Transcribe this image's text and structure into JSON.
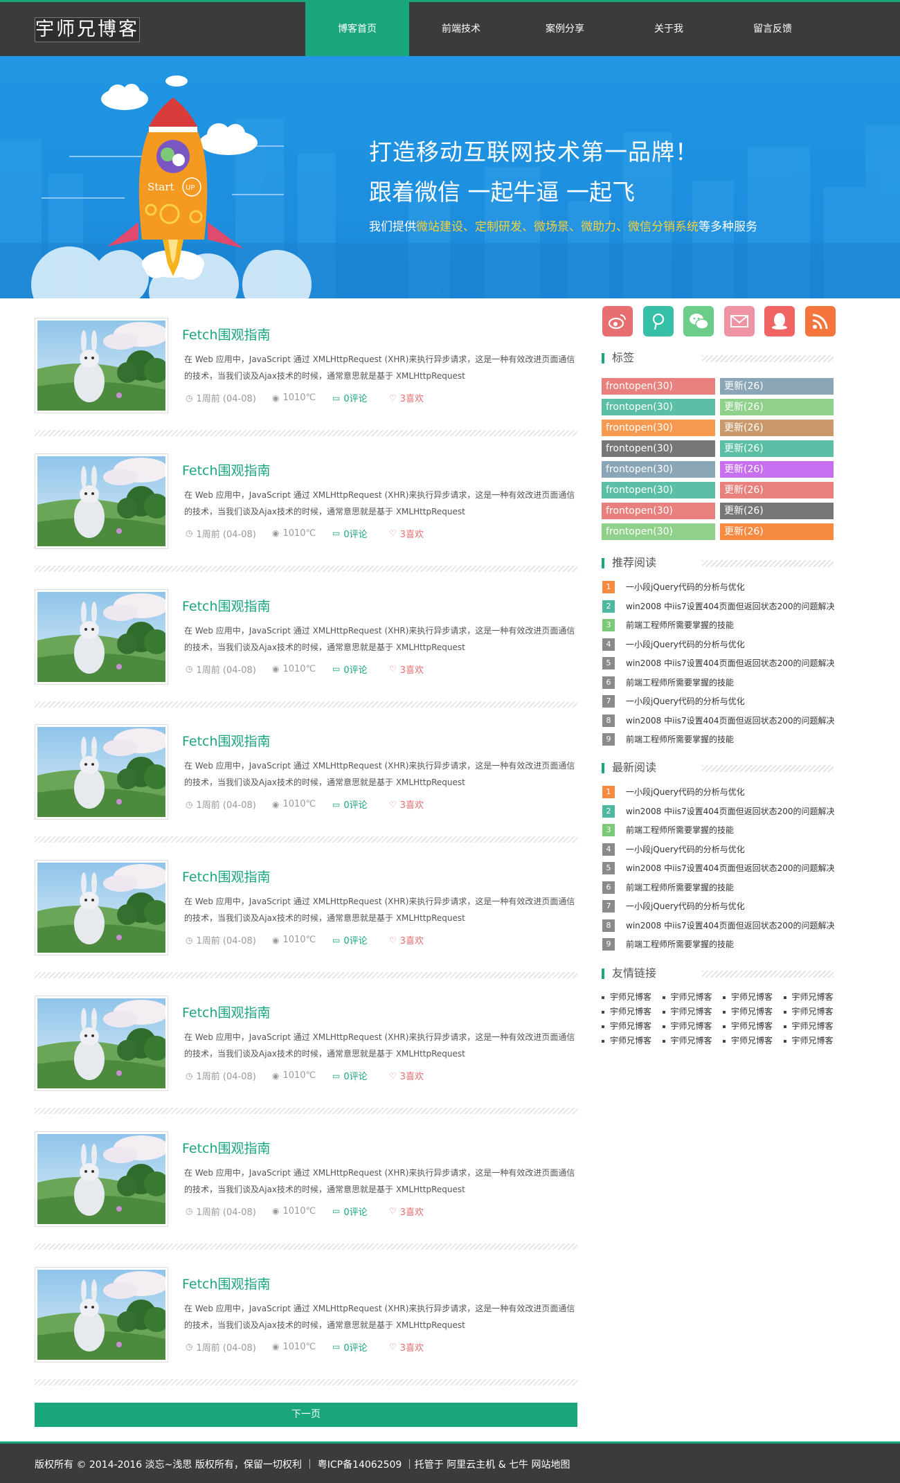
{
  "site": {
    "logo": "宇师兄博客",
    "colors": {
      "accent": "#1aa67c",
      "header_bg": "#3b3b3b",
      "banner_bg": "#1e8fe0",
      "like": "#e76f6f"
    }
  },
  "nav": [
    {
      "label": "博客首页",
      "active": true
    },
    {
      "label": "前端技术",
      "active": false
    },
    {
      "label": "案例分享",
      "active": false
    },
    {
      "label": "关于我",
      "active": false
    },
    {
      "label": "留言反馈",
      "active": false
    }
  ],
  "banner": {
    "line1": "打造移动互联网技术第一品牌！",
    "line2": "跟着微信 一起牛逼 一起飞",
    "line3_pre": "我们提供",
    "line3_highlight": "微站建设、定制研发、微场景、微助力、微信分销系统",
    "line3_post": "等多种服务",
    "rocket_text": "Start",
    "rocket_badge": "UP"
  },
  "posts": [
    {
      "title": "Fetch围观指南",
      "desc": "在 Web 应用中，JavaScript 通过 XMLHttpRequest (XHR)来执行异步请求，这是一种有效改进页面通信的技术，当我们谈及Ajax技术的时候，通常意思就是基于 XMLHttpRequest",
      "time": "1周前 (04-08)",
      "views": "1010℃",
      "comments": "0评论",
      "likes": "3喜欢"
    },
    {
      "title": "Fetch围观指南",
      "desc": "在 Web 应用中，JavaScript 通过 XMLHttpRequest (XHR)来执行异步请求，这是一种有效改进页面通信的技术，当我们谈及Ajax技术的时候，通常意思就是基于 XMLHttpRequest",
      "time": "1周前 (04-08)",
      "views": "1010℃",
      "comments": "0评论",
      "likes": "3喜欢"
    },
    {
      "title": "Fetch围观指南",
      "desc": "在 Web 应用中，JavaScript 通过 XMLHttpRequest (XHR)来执行异步请求，这是一种有效改进页面通信的技术，当我们谈及Ajax技术的时候，通常意思就是基于 XMLHttpRequest",
      "time": "1周前 (04-08)",
      "views": "1010℃",
      "comments": "0评论",
      "likes": "3喜欢"
    },
    {
      "title": "Fetch围观指南",
      "desc": "在 Web 应用中，JavaScript 通过 XMLHttpRequest (XHR)来执行异步请求，这是一种有效改进页面通信的技术，当我们谈及Ajax技术的时候，通常意思就是基于 XMLHttpRequest",
      "time": "1周前 (04-08)",
      "views": "1010℃",
      "comments": "0评论",
      "likes": "3喜欢"
    },
    {
      "title": "Fetch围观指南",
      "desc": "在 Web 应用中，JavaScript 通过 XMLHttpRequest (XHR)来执行异步请求，这是一种有效改进页面通信的技术，当我们谈及Ajax技术的时候，通常意思就是基于 XMLHttpRequest",
      "time": "1周前 (04-08)",
      "views": "1010℃",
      "comments": "0评论",
      "likes": "3喜欢"
    },
    {
      "title": "Fetch围观指南",
      "desc": "在 Web 应用中，JavaScript 通过 XMLHttpRequest (XHR)来执行异步请求，这是一种有效改进页面通信的技术，当我们谈及Ajax技术的时候，通常意思就是基于 XMLHttpRequest",
      "time": "1周前 (04-08)",
      "views": "1010℃",
      "comments": "0评论",
      "likes": "3喜欢"
    },
    {
      "title": "Fetch围观指南",
      "desc": "在 Web 应用中，JavaScript 通过 XMLHttpRequest (XHR)来执行异步请求，这是一种有效改进页面通信的技术，当我们谈及Ajax技术的时候，通常意思就是基于 XMLHttpRequest",
      "time": "1周前 (04-08)",
      "views": "1010℃",
      "comments": "0评论",
      "likes": "3喜欢"
    },
    {
      "title": "Fetch围观指南",
      "desc": "在 Web 应用中，JavaScript 通过 XMLHttpRequest (XHR)来执行异步请求，这是一种有效改进页面通信的技术，当我们谈及Ajax技术的时候，通常意思就是基于 XMLHttpRequest",
      "time": "1周前 (04-08)",
      "views": "1010℃",
      "comments": "0评论",
      "likes": "3喜欢"
    }
  ],
  "next_page": "下一页",
  "sidebar": {
    "social": [
      {
        "icon": "weibo-icon",
        "color": "#e86f6f"
      },
      {
        "icon": "zhihu-pen-icon",
        "color": "#37c0a8"
      },
      {
        "icon": "wechat-icon",
        "color": "#6ccc8a"
      },
      {
        "icon": "mail-icon",
        "color": "#f093a3"
      },
      {
        "icon": "qq-icon",
        "color": "#f06464"
      },
      {
        "icon": "rss-icon",
        "color": "#f4753e"
      }
    ],
    "tags_title": "标签",
    "tags": [
      {
        "left": "frontopen(30)",
        "left_color": "#e8807d",
        "right": "更新(26)",
        "right_color": "#8aa5b5"
      },
      {
        "left": "frontopen(30)",
        "left_color": "#5bbfa6",
        "right": "更新(26)",
        "right_color": "#8fd18a"
      },
      {
        "left": "frontopen(30)",
        "left_color": "#f59a50",
        "right": "更新(26)",
        "right_color": "#c9996c"
      },
      {
        "left": "frontopen(30)",
        "left_color": "#777777",
        "right": "更新(26)",
        "right_color": "#5bbfa6"
      },
      {
        "left": "frontopen(30)",
        "left_color": "#8aa5b5",
        "right": "更新(26)",
        "right_color": "#c86ff0"
      },
      {
        "left": "frontopen(30)",
        "left_color": "#5bbfa6",
        "right": "更新(26)",
        "right_color": "#e8807d"
      },
      {
        "left": "frontopen(30)",
        "left_color": "#e8807d",
        "right": "更新(26)",
        "right_color": "#777777"
      },
      {
        "left": "frontopen(30)",
        "left_color": "#8fd18a",
        "right": "更新(26)",
        "right_color": "#f58a40"
      }
    ],
    "recommend_title": "推荐阅读",
    "recommend": [
      {
        "num": "1",
        "text": "一小段jQuery代码的分析与优化",
        "color": "#f58a40"
      },
      {
        "num": "2",
        "text": "win2008 中iis7设置404页面但返回状态200的问题解决",
        "color": "#4cb8a0"
      },
      {
        "num": "3",
        "text": "前端工程师所需要掌握的技能",
        "color": "#7cc97a"
      },
      {
        "num": "4",
        "text": "一小段jQuery代码的分析与优化",
        "color": "#8a8a8a"
      },
      {
        "num": "5",
        "text": "win2008 中iis7设置404页面但返回状态200的问题解决",
        "color": "#8a8a8a"
      },
      {
        "num": "6",
        "text": "前端工程师所需要掌握的技能",
        "color": "#8a8a8a"
      },
      {
        "num": "7",
        "text": "一小段jQuery代码的分析与优化",
        "color": "#8a8a8a"
      },
      {
        "num": "8",
        "text": "win2008 中iis7设置404页面但返回状态200的问题解决",
        "color": "#8a8a8a"
      },
      {
        "num": "9",
        "text": "前端工程师所需要掌握的技能",
        "color": "#8a8a8a"
      }
    ],
    "latest_title": "最新阅读",
    "latest": [
      {
        "num": "1",
        "text": "一小段jQuery代码的分析与优化",
        "color": "#f58a40"
      },
      {
        "num": "2",
        "text": "win2008 中iis7设置404页面但返回状态200的问题解决",
        "color": "#4cb8a0"
      },
      {
        "num": "3",
        "text": "前端工程师所需要掌握的技能",
        "color": "#7cc97a"
      },
      {
        "num": "4",
        "text": "一小段jQuery代码的分析与优化",
        "color": "#8a8a8a"
      },
      {
        "num": "5",
        "text": "win2008 中iis7设置404页面但返回状态200的问题解决",
        "color": "#8a8a8a"
      },
      {
        "num": "6",
        "text": "前端工程师所需要掌握的技能",
        "color": "#8a8a8a"
      },
      {
        "num": "7",
        "text": "一小段jQuery代码的分析与优化",
        "color": "#8a8a8a"
      },
      {
        "num": "8",
        "text": "win2008 中iis7设置404页面但返回状态200的问题解决",
        "color": "#8a8a8a"
      },
      {
        "num": "9",
        "text": "前端工程师所需要掌握的技能",
        "color": "#8a8a8a"
      }
    ],
    "friends_title": "友情链接",
    "friends": [
      "宇师兄博客",
      "宇师兄博客",
      "宇师兄博客",
      "宇师兄博客",
      "宇师兄博客",
      "宇师兄博客",
      "宇师兄博客",
      "宇师兄博客",
      "宇师兄博客",
      "宇师兄博客",
      "宇师兄博客",
      "宇师兄博客",
      "宇师兄博客",
      "宇师兄博客",
      "宇师兄博客",
      "宇师兄博客"
    ]
  },
  "footer": "版权所有 © 2014-2016 淡忘~浅思 版权所有，保留一切权利 ｜ 粤ICP备14062509 ｜托管于 阿里云主机 & 七牛 网站地图"
}
